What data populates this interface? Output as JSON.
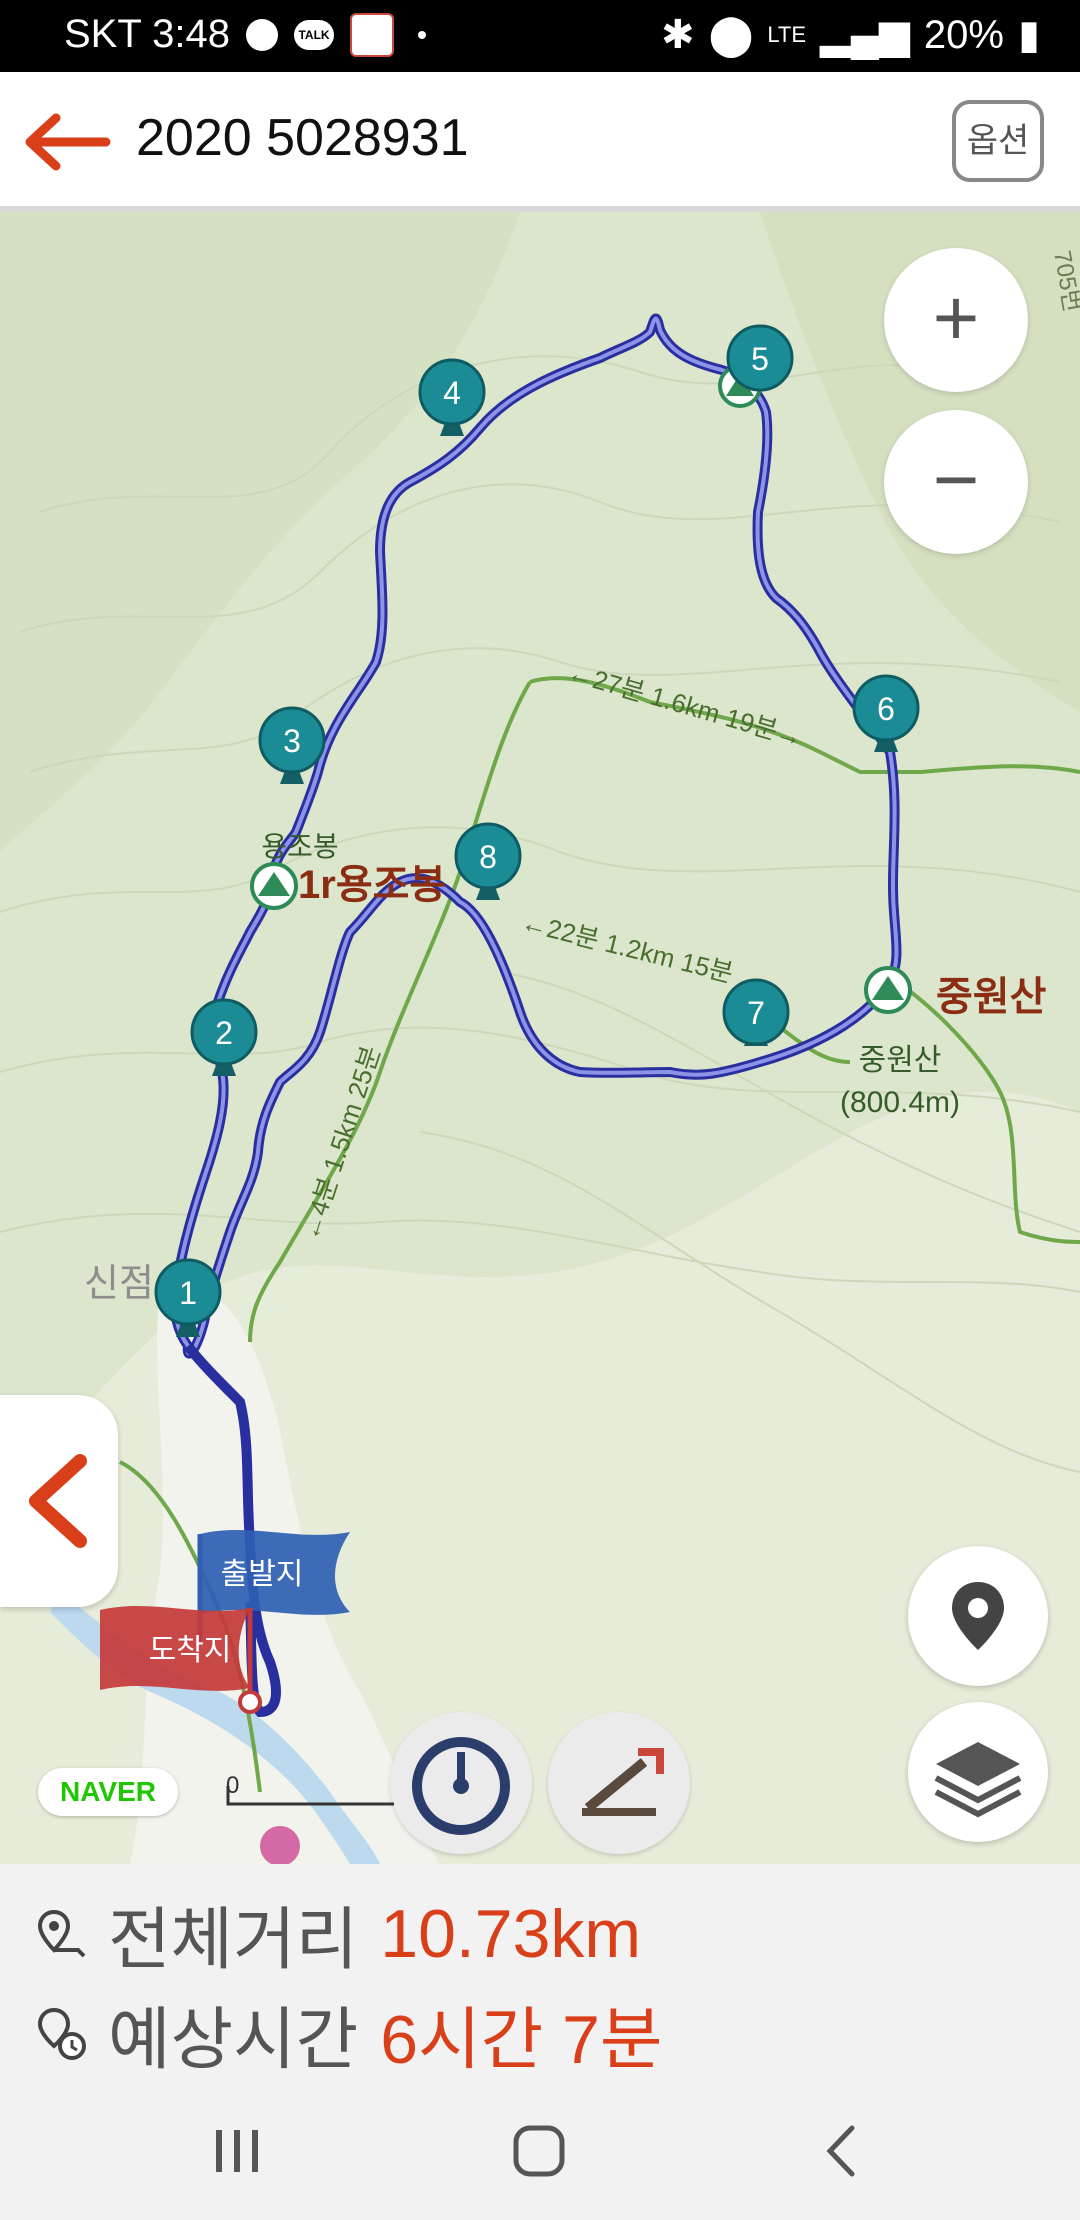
{
  "status_bar": {
    "carrier_time": "SKT 3:48",
    "talk_badge": "TALK",
    "network": "LTE",
    "battery": "20%"
  },
  "header": {
    "title": "2020 5028931",
    "options_label": "옵션"
  },
  "map": {
    "waypoints": [
      "1",
      "2",
      "3",
      "4",
      "5",
      "6",
      "7",
      "8"
    ],
    "peaks": {
      "yongjobong_small": "용조봉",
      "yongjobong_big": "1r용조봉",
      "jungwonsan_big": "중원산",
      "jungwonsan_small": "중원산",
      "jungwonsan_elev": "(800.4m)"
    },
    "trail_labels": {
      "upper": "←27분 1.6km 19분→",
      "middle": "←22분 1.2km 15분",
      "left": "←4분 1.5km 25분"
    },
    "place_label": "신점",
    "flags": {
      "start": "출발지",
      "end": "도착지"
    },
    "route_color": "#3b44c8",
    "marker_color": "#1b8c95",
    "logo": "NAVER",
    "scale_zero": "0",
    "edge_label": "705번"
  },
  "summary": {
    "distance_label": "전체거리",
    "distance_value": "10.73km",
    "time_label": "예상시간",
    "time_value": "6시간 7분"
  },
  "icons": {
    "back": "back-arrow-icon",
    "zoom_in": "plus-icon",
    "zoom_out": "minus-icon",
    "collapse": "chevron-left-icon",
    "location": "location-pin-icon",
    "layers": "layers-icon",
    "speed": "speedometer-icon",
    "elevation": "elevation-icon"
  }
}
